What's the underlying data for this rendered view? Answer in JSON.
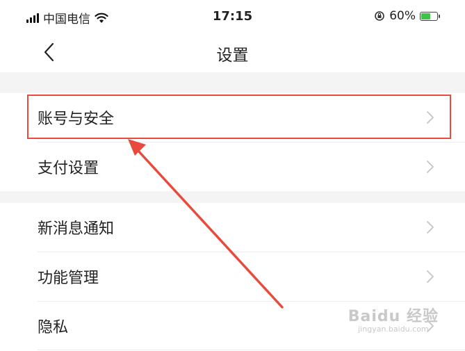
{
  "status_bar": {
    "carrier": "中国电信",
    "time": "17:15",
    "battery_percent": "60%",
    "battery_level": 0.6,
    "battery_color": "#3ec449"
  },
  "nav": {
    "title": "设置",
    "back_icon": "chevron-left-icon"
  },
  "settings": {
    "group1": [
      {
        "label": "账号与安全",
        "highlighted": true
      },
      {
        "label": "支付设置"
      }
    ],
    "group2": [
      {
        "label": "新消息通知"
      },
      {
        "label": "功能管理"
      },
      {
        "label": "隐私"
      }
    ]
  },
  "annotation": {
    "color": "#e84a3c"
  },
  "watermark": {
    "main": "Baidu 经验",
    "sub": "jingyan.baidu.com"
  }
}
